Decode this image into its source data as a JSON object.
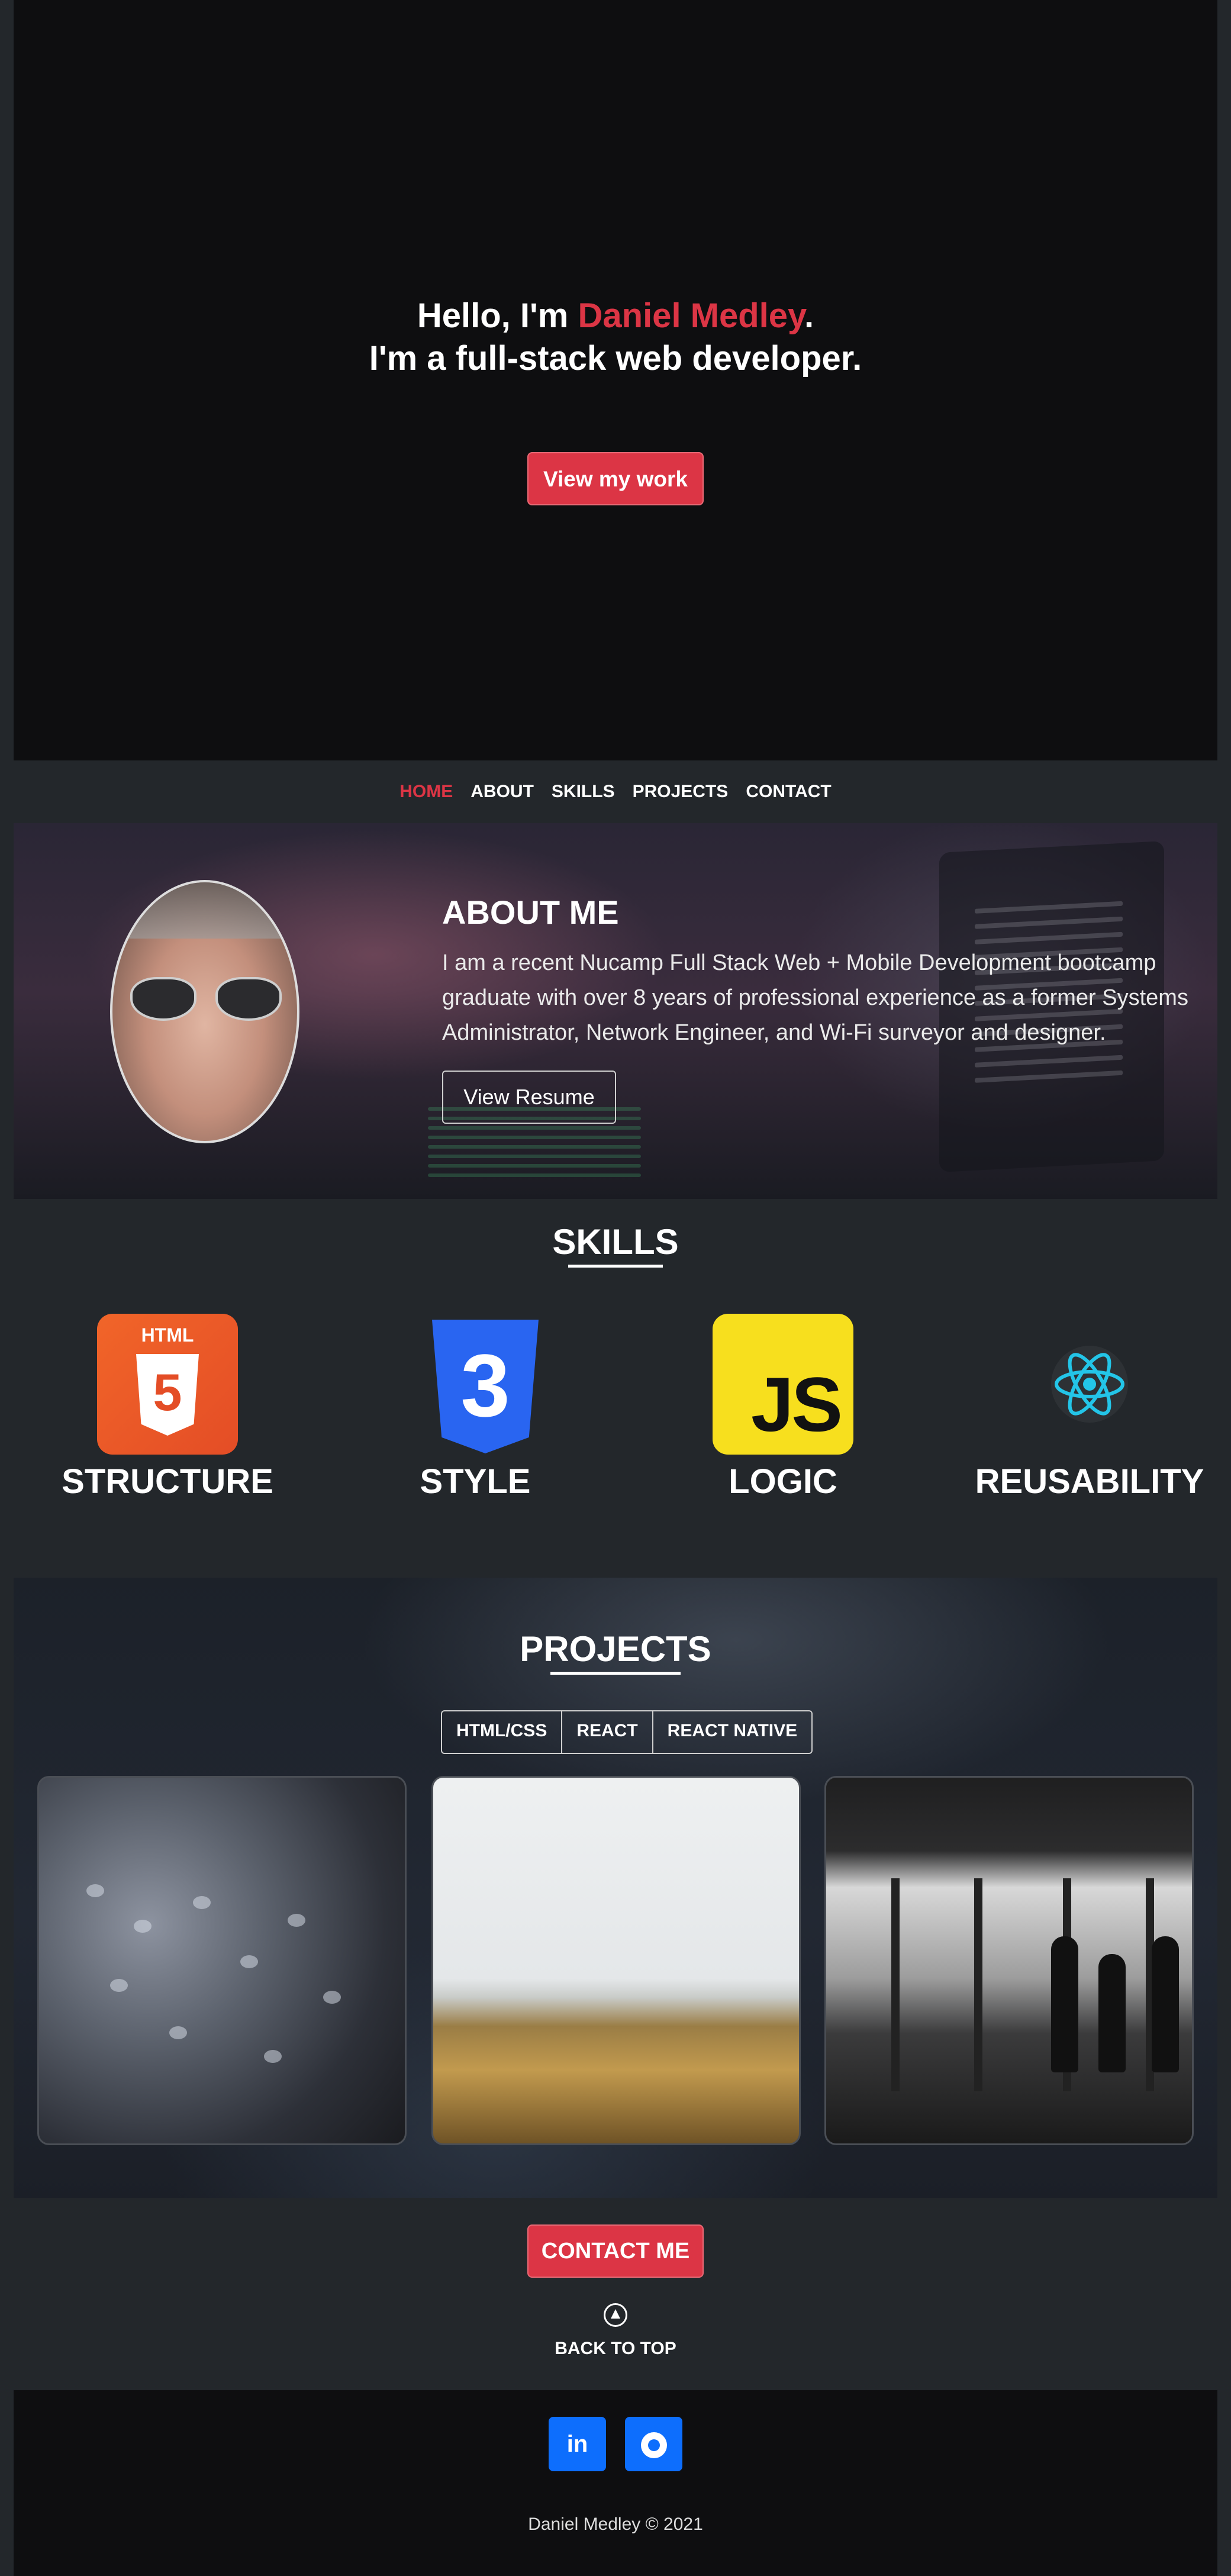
{
  "hero": {
    "greeting_prefix": "Hello, I'm ",
    "name": "Daniel Medley",
    "greeting_suffix": ".",
    "tagline": "I'm a full-stack web developer.",
    "cta_label": "View my work"
  },
  "nav": {
    "items": [
      {
        "label": "HOME",
        "active": true
      },
      {
        "label": "ABOUT",
        "active": false
      },
      {
        "label": "SKILLS",
        "active": false
      },
      {
        "label": "PROJECTS",
        "active": false
      },
      {
        "label": "CONTACT",
        "active": false
      }
    ]
  },
  "about": {
    "title": "ABOUT ME",
    "body": "I am a recent Nucamp Full Stack Web + Mobile Development bootcamp graduate with over 8 years of professional experience as a former Systems Administrator, Network Engineer, and Wi-Fi surveyor and designer.",
    "resume_label": "View Resume"
  },
  "skills": {
    "title": "SKILLS",
    "items": [
      {
        "label": "STRUCTURE",
        "icon": "html5-icon",
        "badge": "HTML",
        "glyph": "5"
      },
      {
        "label": "STYLE",
        "icon": "css3-icon",
        "glyph": "3"
      },
      {
        "label": "LOGIC",
        "icon": "javascript-icon",
        "glyph": "JS"
      },
      {
        "label": "REUSABILITY",
        "icon": "react-icon"
      }
    ]
  },
  "projects": {
    "title": "PROJECTS",
    "filters": [
      "HTML/CSS",
      "REACT",
      "REACT NATIVE"
    ]
  },
  "contact": {
    "cta_label": "CONTACT ME",
    "back_to_top": "BACK TO TOP"
  },
  "footer": {
    "linkedin_label": "in",
    "copyright": "Daniel Medley © 2021"
  },
  "colors": {
    "accent": "#dc3545",
    "social": "#0d6efd",
    "dark": "#0e0e10",
    "panel": "#23272b"
  }
}
